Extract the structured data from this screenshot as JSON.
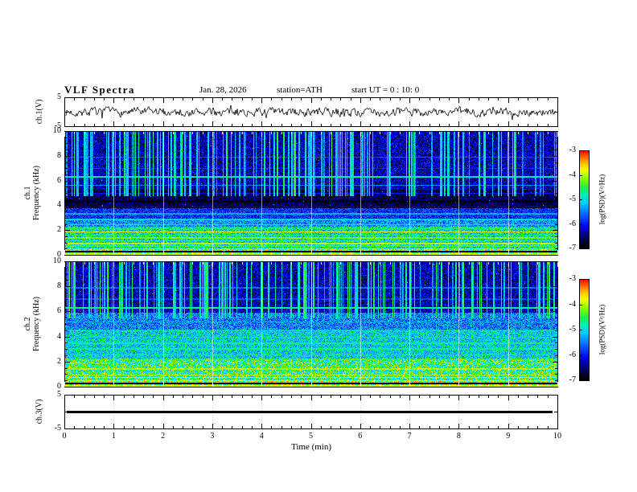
{
  "header": {
    "title": "VLF  Spectra",
    "date": "Jan. 28, 2026",
    "station": "station=ATH",
    "start_ut": "start UT =   0 : 10: 0"
  },
  "axes": {
    "time_label": "Time (min)",
    "time_ticks": [
      "0",
      "1",
      "2",
      "3",
      "4",
      "5",
      "6",
      "7",
      "8",
      "9",
      "10"
    ],
    "time_range": [
      0,
      10
    ]
  },
  "panels": {
    "wave1": {
      "ylabel": "ch.1(V)",
      "yticks": [
        "5",
        "-5"
      ],
      "ylim": [
        -5,
        5
      ]
    },
    "spec1": {
      "ylabel_ch": "ch.1",
      "ylabel_freq": "Frequency (kHz)",
      "yticks": [
        "10",
        "8",
        "6",
        "4",
        "2",
        "0"
      ],
      "ylim": [
        0,
        10
      ]
    },
    "spec2": {
      "ylabel_ch": "ch.2",
      "ylabel_freq": "Frequency (kHz)",
      "yticks": [
        "10",
        "8",
        "6",
        "4",
        "2",
        "0"
      ],
      "ylim": [
        0,
        10
      ]
    },
    "wave3": {
      "ylabel": "ch.3(V)",
      "yticks": [
        "5",
        "-5"
      ],
      "ylim": [
        -5,
        5
      ]
    }
  },
  "colorbar": {
    "label": "log(PSD)(V²/Hz)",
    "ticks": [
      "-3",
      "-4",
      "-5",
      "-6",
      "-7"
    ],
    "value_range": [
      -7,
      -3
    ],
    "colormap": [
      {
        "t": 0.0,
        "c": "#000000"
      },
      {
        "t": 0.1,
        "c": "#000055"
      },
      {
        "t": 0.22,
        "c": "#0000ee"
      },
      {
        "t": 0.35,
        "c": "#0066ff"
      },
      {
        "t": 0.47,
        "c": "#00ccff"
      },
      {
        "t": 0.55,
        "c": "#00eebb"
      },
      {
        "t": 0.63,
        "c": "#22ee44"
      },
      {
        "t": 0.72,
        "c": "#88ff00"
      },
      {
        "t": 0.8,
        "c": "#eeff00"
      },
      {
        "t": 0.87,
        "c": "#ffcc00"
      },
      {
        "t": 0.93,
        "c": "#ff7700"
      },
      {
        "t": 1.0,
        "c": "#ff1100"
      }
    ]
  },
  "chart_data": [
    {
      "id": "ch1_waveform",
      "type": "line",
      "title": "ch.1 voltage waveform",
      "ylabel": "ch.1(V)",
      "ylim": [
        -5,
        5
      ],
      "xlim_min": [
        0,
        10
      ],
      "line_color": "#000000",
      "signal": {
        "baseline": 0,
        "noise_amp": 1.3,
        "smooth": 0.45,
        "spike_prob": 0.05,
        "spike_amp": 1.8,
        "seed": 7
      },
      "description": "dense noisy trace centered on 0 V, excursions roughly ±1.5 V with occasional ±2.5 V spikes"
    },
    {
      "id": "ch1_spectrogram",
      "type": "heatmap",
      "title": "ch.1 VLF spectrogram",
      "xlim": [
        0,
        10
      ],
      "ylim": [
        0,
        10
      ],
      "value_range": [
        -7,
        -3
      ],
      "seed": 11,
      "bands": [
        {
          "f0": 0.0,
          "f1": 0.1,
          "v": -6.9,
          "noise": 0.2
        },
        {
          "f0": 0.1,
          "f1": 0.5,
          "v": -4.3,
          "noise": 0.9
        },
        {
          "f0": 0.5,
          "f1": 2.3,
          "v": -4.9,
          "noise": 0.75
        },
        {
          "f0": 2.3,
          "f1": 3.0,
          "v": -5.4,
          "noise": 0.55
        },
        {
          "f0": 3.0,
          "f1": 3.8,
          "v": -5.9,
          "noise": 0.5
        },
        {
          "f0": 3.8,
          "f1": 5.3,
          "v": -6.65,
          "noise": 0.4
        },
        {
          "f0": 5.3,
          "f1": 10.01,
          "v": -6.3,
          "noise": 0.5
        }
      ],
      "hlines": [
        {
          "f": 0.15,
          "v": -3.9,
          "w": 0.06
        },
        {
          "f": 0.32,
          "v": -6.8,
          "w": 0.05
        },
        {
          "f": 0.55,
          "v": -4.1,
          "w": 0.05
        },
        {
          "f": 0.78,
          "v": -4.4,
          "w": 0.04
        },
        {
          "f": 0.98,
          "v": -4.0,
          "w": 0.05
        },
        {
          "f": 1.2,
          "v": -4.5,
          "w": 0.04
        },
        {
          "f": 1.42,
          "v": -4.2,
          "w": 0.05
        },
        {
          "f": 1.65,
          "v": -4.5,
          "w": 0.04
        },
        {
          "f": 1.9,
          "v": -3.8,
          "w": 0.05
        },
        {
          "f": 2.15,
          "v": -4.6,
          "w": 0.04
        },
        {
          "f": 2.5,
          "v": -4.9,
          "w": 0.04
        },
        {
          "f": 2.9,
          "v": -5.1,
          "w": 0.04
        },
        {
          "f": 3.35,
          "v": -5.3,
          "w": 0.04
        },
        {
          "f": 4.35,
          "v": -7.0,
          "w": 0.1
        },
        {
          "f": 5.0,
          "v": -6.0,
          "w": 0.04
        },
        {
          "f": 5.65,
          "v": -5.5,
          "w": 0.05
        },
        {
          "f": 6.3,
          "v": -4.9,
          "w": 0.06
        },
        {
          "f": 7.0,
          "v": -5.9,
          "w": 0.04
        },
        {
          "f": 7.9,
          "v": -5.7,
          "w": 0.05
        }
      ],
      "streaks": {
        "region": [
          4.8,
          10
        ],
        "prob": 0.22,
        "v_base": -5.9,
        "v_var": 1.5,
        "seed": 13
      },
      "speckle": {
        "prob": 0.004,
        "v": -4.8
      },
      "description": "blue background above 5 kHz with dense vertical sferic streaks; dark band 3.8-5.3 kHz; bright green/yellow harmonic lines below 2.3 kHz"
    },
    {
      "id": "ch2_spectrogram",
      "type": "heatmap",
      "title": "ch.2 VLF spectrogram",
      "xlim": [
        0,
        10
      ],
      "ylim": [
        0,
        10
      ],
      "value_range": [
        -7,
        -3
      ],
      "seed": 21,
      "bands": [
        {
          "f0": 0.0,
          "f1": 0.1,
          "v": -6.9,
          "noise": 0.2
        },
        {
          "f0": 0.1,
          "f1": 0.5,
          "v": -4.1,
          "noise": 0.9
        },
        {
          "f0": 0.5,
          "f1": 2.3,
          "v": -4.55,
          "noise": 0.8
        },
        {
          "f0": 2.3,
          "f1": 4.6,
          "v": -5.05,
          "noise": 0.6
        },
        {
          "f0": 4.6,
          "f1": 5.9,
          "v": -5.5,
          "noise": 0.55
        },
        {
          "f0": 5.9,
          "f1": 10.01,
          "v": -6.3,
          "noise": 0.5
        }
      ],
      "hlines": [
        {
          "f": 0.15,
          "v": -3.8,
          "w": 0.06
        },
        {
          "f": 0.32,
          "v": -6.8,
          "w": 0.05
        },
        {
          "f": 0.55,
          "v": -3.9,
          "w": 0.05
        },
        {
          "f": 0.78,
          "v": -3.7,
          "w": 0.04
        },
        {
          "f": 0.98,
          "v": -4.0,
          "w": 0.05
        },
        {
          "f": 1.2,
          "v": -4.3,
          "w": 0.04
        },
        {
          "f": 1.45,
          "v": -4.0,
          "w": 0.05
        },
        {
          "f": 1.7,
          "v": -4.4,
          "w": 0.04
        },
        {
          "f": 1.95,
          "v": -3.5,
          "w": 0.05
        },
        {
          "f": 2.2,
          "v": -4.4,
          "w": 0.04
        },
        {
          "f": 2.6,
          "v": -4.6,
          "w": 0.04
        },
        {
          "f": 3.05,
          "v": -4.7,
          "w": 0.04
        },
        {
          "f": 3.5,
          "v": -4.8,
          "w": 0.04
        },
        {
          "f": 4.0,
          "v": -4.9,
          "w": 0.04
        },
        {
          "f": 4.5,
          "v": -5.0,
          "w": 0.04
        },
        {
          "f": 5.2,
          "v": -5.3,
          "w": 0.04
        },
        {
          "f": 6.3,
          "v": -4.8,
          "w": 0.06
        },
        {
          "f": 7.0,
          "v": -5.8,
          "w": 0.04
        },
        {
          "f": 7.9,
          "v": -5.6,
          "w": 0.05
        }
      ],
      "streaks": {
        "region": [
          5.5,
          10
        ],
        "prob": 0.22,
        "v_base": -5.9,
        "v_var": 1.5,
        "seed": 23
      },
      "speckle": {
        "prob": 0.004,
        "v": -4.8
      },
      "description": "brighter green/cyan up to ~5 kHz with orange harmonic lines below 2.3 kHz; dark blue above 6 kHz with vertical sferic streaks"
    },
    {
      "id": "ch3_waveform",
      "type": "line",
      "title": "ch.3 voltage (flat)",
      "ylabel": "ch.3(V)",
      "ylim": [
        -5,
        5
      ],
      "value": 0,
      "line_width": 3,
      "line_color": "#000000",
      "description": "flat thick black line at 0 V for entire 10 minutes"
    }
  ]
}
